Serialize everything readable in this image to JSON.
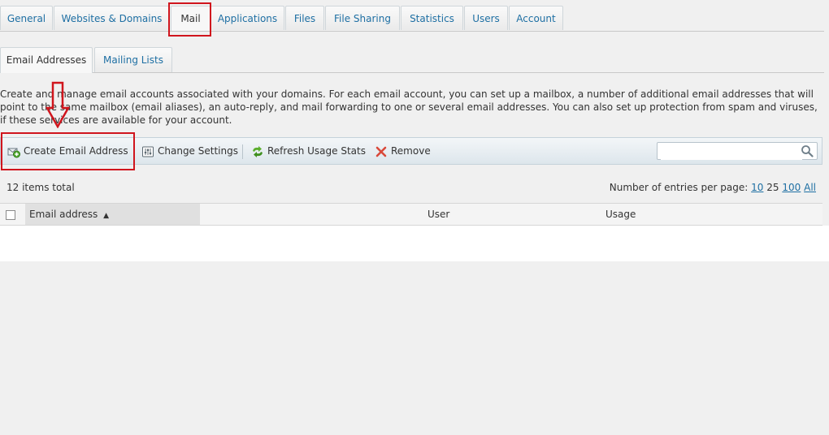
{
  "top_tabs": [
    {
      "label": "General"
    },
    {
      "label": "Websites & Domains"
    },
    {
      "label": "Mail"
    },
    {
      "label": "Applications"
    },
    {
      "label": "Files"
    },
    {
      "label": "File Sharing"
    },
    {
      "label": "Statistics"
    },
    {
      "label": "Users"
    },
    {
      "label": "Account"
    }
  ],
  "sub_tabs": [
    {
      "label": "Email Addresses"
    },
    {
      "label": "Mailing Lists"
    }
  ],
  "description": "Create and manage email accounts associated with your domains. For each email account, you can set up a mailbox, a number of additional email addresses that will point to the same mailbox (email aliases), an auto-reply, and mail forwarding to one or several email addresses. You can also set up protection from spam and viruses, if these services are available for your account.",
  "toolbar": {
    "create_label": "Create Email Address",
    "settings_label": "Change Settings",
    "refresh_label": "Refresh Usage Stats",
    "remove_label": "Remove",
    "search_placeholder": ""
  },
  "list": {
    "total": "12 items total",
    "per_page_label": "Number of entries per page:",
    "per_page_options": [
      "10",
      "25",
      "100",
      "All"
    ],
    "per_page_current": "25"
  },
  "table": {
    "columns": [
      "Email address",
      "User",
      "Usage"
    ],
    "sort_indicator": "▲"
  },
  "icons": [
    "add-mail-icon",
    "settings-icon",
    "refresh-icon",
    "remove-icon",
    "search-icon",
    "sort-asc-icon"
  ],
  "colors": {
    "link": "#1e6fa3",
    "annotation": "#d0151d"
  }
}
